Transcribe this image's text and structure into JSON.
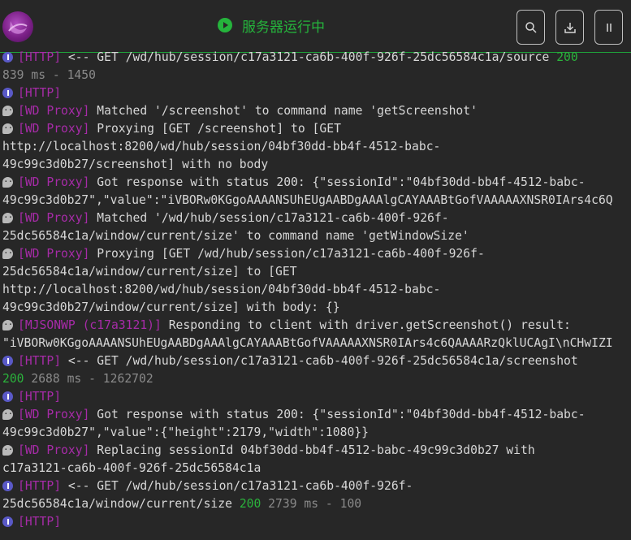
{
  "header": {
    "status_text": "服务器运行中",
    "status_color": "#25b43c",
    "buttons": [
      "search-icon",
      "download-icon",
      "pause-icon"
    ]
  },
  "log": [
    {
      "icon": "info",
      "tag": "[HTTP]",
      "text": " <-- GET /wd/hub/session/c17a3121-ca6b-400f-926f-25dc56584c1a/source ",
      "code": "200"
    },
    {
      "icon": "",
      "tag": "",
      "text": "",
      "dim": "839 ms - 1450"
    },
    {
      "icon": "info",
      "tag": "[HTTP]",
      "text": ""
    },
    {
      "icon": "chat",
      "tag": "[WD Proxy]",
      "text": " Matched '/screenshot' to command name 'getScreenshot'"
    },
    {
      "icon": "chat",
      "tag": "[WD Proxy]",
      "text": " Proxying [GET /screenshot] to [GET"
    },
    {
      "icon": "",
      "tag": "",
      "text": "http://localhost:8200/wd/hub/session/04bf30dd-bb4f-4512-babc-"
    },
    {
      "icon": "",
      "tag": "",
      "text": "49c99c3d0b27/screenshot] with no body"
    },
    {
      "icon": "chat",
      "tag": "[WD Proxy]",
      "text": " Got response with status 200: {\"sessionId\":\"04bf30dd-bb4f-4512-babc-"
    },
    {
      "icon": "",
      "tag": "",
      "text": "49c99c3d0b27\",\"value\":\"iVBORw0KGgoAAAANSUhEUgAABDgAAAlgCAYAAABtGofVAAAAAXNSR0IArs4c6Q"
    },
    {
      "icon": "chat",
      "tag": "[WD Proxy]",
      "text": " Matched '/wd/hub/session/c17a3121-ca6b-400f-926f-"
    },
    {
      "icon": "",
      "tag": "",
      "text": "25dc56584c1a/window/current/size' to command name 'getWindowSize'"
    },
    {
      "icon": "chat",
      "tag": "[WD Proxy]",
      "text": " Proxying [GET /wd/hub/session/c17a3121-ca6b-400f-926f-"
    },
    {
      "icon": "",
      "tag": "",
      "text": "25dc56584c1a/window/current/size] to [GET"
    },
    {
      "icon": "",
      "tag": "",
      "text": "http://localhost:8200/wd/hub/session/04bf30dd-bb4f-4512-babc-"
    },
    {
      "icon": "",
      "tag": "",
      "text": "49c99c3d0b27/window/current/size] with body: {}"
    },
    {
      "icon": "chat",
      "tag": "[MJSONWP (c17a3121)]",
      "text": " Responding to client with driver.getScreenshot() result:"
    },
    {
      "icon": "",
      "tag": "",
      "text": "\"iVBORw0KGgoAAAANSUhEUgAABDgAAAlgCAYAAABtGofVAAAAAXNSR0IArs4c6QAAAARzQklUCAgI\\nCHwIZI"
    },
    {
      "icon": "info",
      "tag": "[HTTP]",
      "text": " <-- GET /wd/hub/session/c17a3121-ca6b-400f-926f-25dc56584c1a/screenshot"
    },
    {
      "icon": "",
      "tag": "",
      "text": "",
      "code": "200",
      "dim": " 2688 ms - 1262702"
    },
    {
      "icon": "info",
      "tag": "[HTTP]",
      "text": ""
    },
    {
      "icon": "chat",
      "tag": "[WD Proxy]",
      "text": " Got response with status 200: {\"sessionId\":\"04bf30dd-bb4f-4512-babc-"
    },
    {
      "icon": "",
      "tag": "",
      "text": "49c99c3d0b27\",\"value\":{\"height\":2179,\"width\":1080}}"
    },
    {
      "icon": "chat",
      "tag": "[WD Proxy]",
      "text": " Replacing sessionId 04bf30dd-bb4f-4512-babc-49c99c3d0b27 with"
    },
    {
      "icon": "",
      "tag": "",
      "text": "c17a3121-ca6b-400f-926f-25dc56584c1a"
    },
    {
      "icon": "info",
      "tag": "[HTTP]",
      "text": " <-- GET /wd/hub/session/c17a3121-ca6b-400f-926f-"
    },
    {
      "icon": "",
      "tag": "",
      "text": "25dc56584c1a/window/current/size ",
      "code": "200",
      "dim": " 2739 ms - 100"
    },
    {
      "icon": "info",
      "tag": "[HTTP]",
      "text": ""
    }
  ],
  "colors": {
    "tag": "#a72ba8",
    "ok": "#2bb33c",
    "dim": "#8a8a8a",
    "text": "#d7d7d7",
    "background": "#272727"
  }
}
